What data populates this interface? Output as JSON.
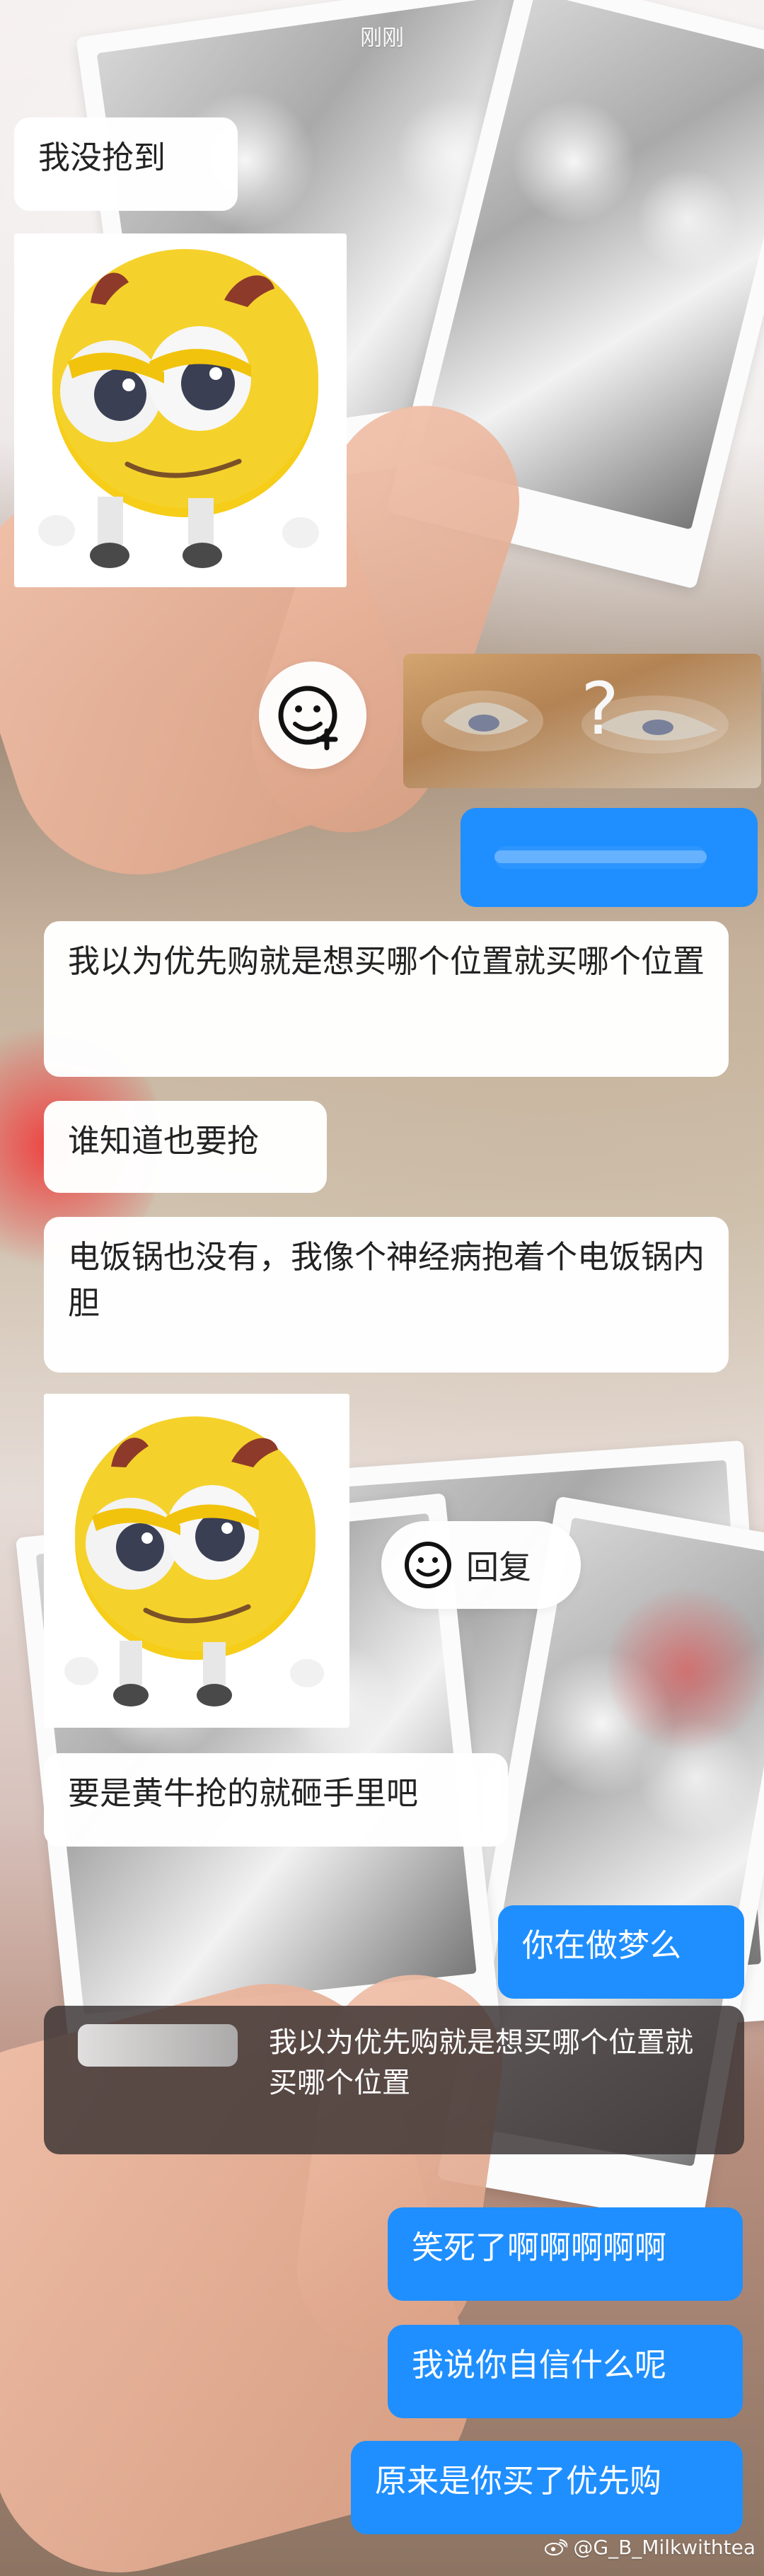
{
  "chat": {
    "timestamp": "刚刚",
    "messages": [
      "我没抢到",
      "我以为优先购就是想买哪个位置就买哪个位置",
      "谁知道也要抢",
      "电饭锅也没有，我像个神经病抱着个电饭锅内胆",
      "要是黄牛抢的就砸手里吧",
      "你在做梦么",
      "笑死了啊啊啊啊啊",
      "我说你自信什么呢",
      "原来是你买了优先购"
    ],
    "quoted_message": "我以为优先购就是想买哪个位置就买哪个位置",
    "blurred_outgoing_message": "",
    "reply_label": "回复"
  },
  "watermark": {
    "text": "@G_B_Milkwithtea"
  },
  "colors": {
    "outgoing_bubble": "#1f8fff",
    "incoming_bubble": "#ffffff",
    "quote_bubble": "#3d3534"
  },
  "icons": {
    "add_emoji": "add-emoji-icon",
    "reply_face": "face-icon",
    "question_mark": "question-mark-icon",
    "weibo": "weibo-icon"
  }
}
